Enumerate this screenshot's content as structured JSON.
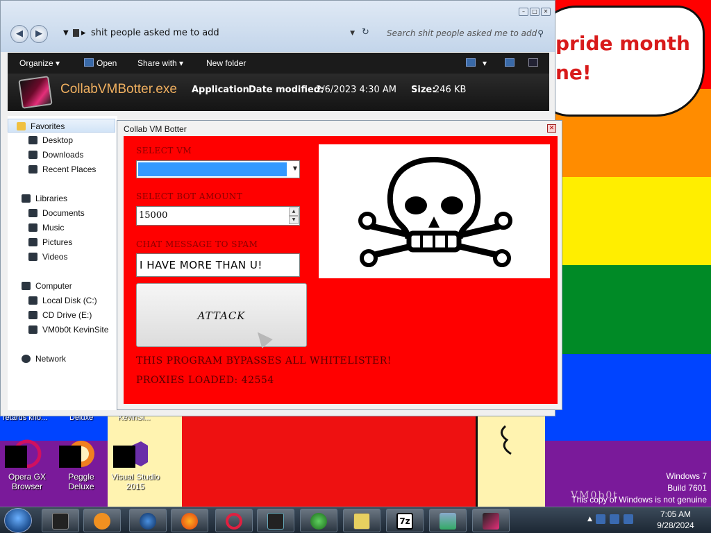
{
  "wallpaper": {
    "bubble_text_line1": "pride month",
    "bubble_text_line2": "ne!",
    "windows_version": "Windows 7",
    "build": "Build 7601",
    "genuine_notice": "This copy of Windows is not genuine",
    "vm_tag": "VM0b0t",
    "colors": [
      "#ff0000",
      "#ff8c00",
      "#ffee00",
      "#008a26",
      "#0044ff",
      "#7a1a9a"
    ]
  },
  "desktop": {
    "partial_labels": [
      "retards kno...",
      "Deluxe",
      "KevinSi..."
    ],
    "icons": [
      {
        "label": "Opera GX Browser",
        "icon": "opera-gx-icon"
      },
      {
        "label": "Peggle Deluxe",
        "icon": "peggle-icon"
      },
      {
        "label": "Visual Studio 2015",
        "icon": "visual-studio-icon"
      }
    ]
  },
  "explorer": {
    "address": "shit people asked me to add",
    "search_placeholder": "Search shit people asked me to add",
    "toolbar": {
      "organize": "Organize",
      "open": "Open",
      "share_with": "Share with",
      "new_folder": "New folder"
    },
    "details": {
      "file_name": "CollabVMBotter.exe",
      "file_type": "Application",
      "date_modified_label": "Date modified:",
      "date_modified": "2/6/2023 4:30 AM",
      "size_label": "Size:",
      "size": "246 KB"
    },
    "nav": {
      "favorites": "Favorites",
      "desktop": "Desktop",
      "downloads": "Downloads",
      "recent_places": "Recent Places",
      "libraries": "Libraries",
      "documents": "Documents",
      "music": "Music",
      "pictures": "Pictures",
      "videos": "Videos",
      "computer": "Computer",
      "local_disk": "Local Disk (C:)",
      "cd_drive": "CD Drive (E:)",
      "vm_site": "VM0b0t KevinSite",
      "network": "Network"
    }
  },
  "botter": {
    "title": "Collab VM Botter",
    "select_vm_label": "SELECT VM",
    "select_vm_value": "",
    "bot_amount_label": "SELECT BOT AMOUNT",
    "bot_amount": "15000",
    "chat_label": "CHAT MESSAGE TO SPAM",
    "chat_message": "I HAVE MORE THAN U!",
    "attack_label": "ATTACK",
    "bypass_text": "THIS PROGRAM BYPASSES ALL WHITELISTER!",
    "proxies_text": "PROXIES LOADED: 42554",
    "image": "skull-and-crossbones-icon"
  },
  "taskbar": {
    "time": "7:05 AM",
    "date": "9/28/2024",
    "pinned": [
      "terminal-icon",
      "media-player-icon",
      "globe-icon",
      "firefox-icon",
      "opera-icon",
      "monitor-icon",
      "download-manager-icon",
      "checklist-icon",
      "7zip-icon",
      "transfer-icon",
      "collabvm-botter-icon"
    ],
    "sevenzip_label": "7z"
  }
}
